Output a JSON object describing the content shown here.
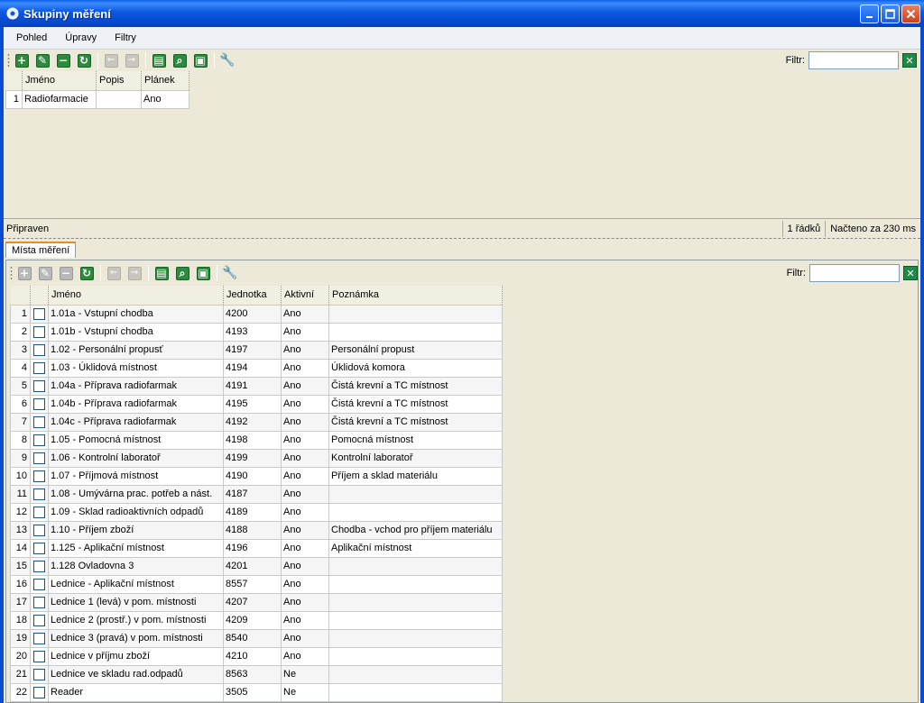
{
  "window": {
    "title": "Skupiny měření"
  },
  "menu": {
    "items": [
      "Pohled",
      "Úpravy",
      "Filtry"
    ]
  },
  "filter_label": "Filtr:",
  "groups": {
    "columns": [
      "Jméno",
      "Popis",
      "Plánek"
    ],
    "rows": [
      {
        "num": "1",
        "name": "Radiofarmacie",
        "desc": "",
        "plan": "Ano"
      }
    ]
  },
  "status": {
    "state": "Připraven",
    "rows": "1 řádků",
    "loaded": "Načteno za 230 ms"
  },
  "tab": {
    "label": "Místa měření"
  },
  "places": {
    "columns": [
      "Jméno",
      "Jednotka",
      "Aktivní",
      "Poznámka"
    ],
    "rows": [
      {
        "num": "1",
        "name": "1.01a - Vstupní chodba",
        "unit": "4200",
        "active": "Ano",
        "note": ""
      },
      {
        "num": "2",
        "name": "1.01b - Vstupní chodba",
        "unit": "4193",
        "active": "Ano",
        "note": ""
      },
      {
        "num": "3",
        "name": "1.02 - Personální propusť",
        "unit": "4197",
        "active": "Ano",
        "note": "Personální propust"
      },
      {
        "num": "4",
        "name": "1.03 - Úklidová místnost",
        "unit": "4194",
        "active": "Ano",
        "note": "Úklidová komora"
      },
      {
        "num": "5",
        "name": "1.04a - Příprava radiofarmak",
        "unit": "4191",
        "active": "Ano",
        "note": "Čistá krevní a TC místnost"
      },
      {
        "num": "6",
        "name": "1.04b - Příprava radiofarmak",
        "unit": "4195",
        "active": "Ano",
        "note": "Čistá krevní a TC místnost"
      },
      {
        "num": "7",
        "name": "1.04c - Příprava radiofarmak",
        "unit": "4192",
        "active": "Ano",
        "note": "Čistá krevní a TC místnost"
      },
      {
        "num": "8",
        "name": "1.05 - Pomocná místnost",
        "unit": "4198",
        "active": "Ano",
        "note": "Pomocná místnost"
      },
      {
        "num": "9",
        "name": "1.06 - Kontrolní laboratoř",
        "unit": "4199",
        "active": "Ano",
        "note": "Kontrolní laboratoř"
      },
      {
        "num": "10",
        "name": "1.07 - Příjmová místnost",
        "unit": "4190",
        "active": "Ano",
        "note": "Příjem a sklad materiálu"
      },
      {
        "num": "11",
        "name": "1.08 - Umývárna prac. potřeb a nást.",
        "unit": "4187",
        "active": "Ano",
        "note": ""
      },
      {
        "num": "12",
        "name": "1.09 - Sklad radioaktivních odpadů",
        "unit": "4189",
        "active": "Ano",
        "note": ""
      },
      {
        "num": "13",
        "name": "1.10 - Příjem zboží",
        "unit": "4188",
        "active": "Ano",
        "note": "Chodba - vchod pro příjem materiálu"
      },
      {
        "num": "14",
        "name": "1.125 - Aplikační místnost",
        "unit": "4196",
        "active": "Ano",
        "note": "Aplikační místnost"
      },
      {
        "num": "15",
        "name": "1.128 Ovladovna 3",
        "unit": "4201",
        "active": "Ano",
        "note": ""
      },
      {
        "num": "16",
        "name": "Lednice - Aplikační místnost",
        "unit": "8557",
        "active": "Ano",
        "note": ""
      },
      {
        "num": "17",
        "name": "Lednice 1 (levá) v pom. místnosti",
        "unit": "4207",
        "active": "Ano",
        "note": ""
      },
      {
        "num": "18",
        "name": "Lednice 2 (prostř.) v pom. místnosti",
        "unit": "4209",
        "active": "Ano",
        "note": ""
      },
      {
        "num": "19",
        "name": "Lednice 3 (pravá) v pom. místnosti",
        "unit": "8540",
        "active": "Ano",
        "note": ""
      },
      {
        "num": "20",
        "name": "Lednice v příjmu zboží",
        "unit": "4210",
        "active": "Ano",
        "note": ""
      },
      {
        "num": "21",
        "name": "Lednice ve skladu rad.odpadů",
        "unit": "8563",
        "active": "Ne",
        "note": ""
      },
      {
        "num": "22",
        "name": "Reader",
        "unit": "3505",
        "active": "Ne",
        "note": ""
      }
    ]
  },
  "icons": {
    "toolbar": [
      "add-icon",
      "edit-icon",
      "delete-icon",
      "refresh-icon",
      "back-icon",
      "forward-icon",
      "print-icon",
      "print-preview-icon",
      "save-icon",
      "settings-icon"
    ],
    "accent_green": "#2e8b3e",
    "title_blue": "#0a58e0"
  }
}
